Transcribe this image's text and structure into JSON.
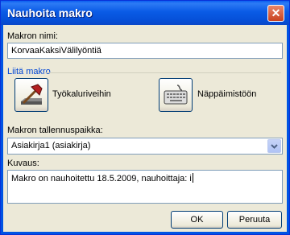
{
  "window": {
    "title": "Nauhoita makro"
  },
  "macro_name": {
    "label": "Makron nimi:",
    "value": "KorvaaKaksiVälilyöntiä"
  },
  "assign_group": {
    "title": "Liitä makro",
    "toolbar_button_label": "Työkaluriveihin",
    "keyboard_button_label": "Näppäimistöön"
  },
  "store_in": {
    "label": "Makron tallennuspaikka:",
    "selected": "Asiakirja1 (asiakirja)"
  },
  "description": {
    "label": "Kuvaus:",
    "value": "Makro on nauhoitettu 18.5.2009, nauhoittaja: i"
  },
  "buttons": {
    "ok": "OK",
    "cancel": "Peruuta"
  },
  "icons": {
    "toolbar": "hammer-icon",
    "keyboard": "keyboard-icon",
    "close": "close-icon",
    "dropdown": "chevron-down-icon"
  }
}
